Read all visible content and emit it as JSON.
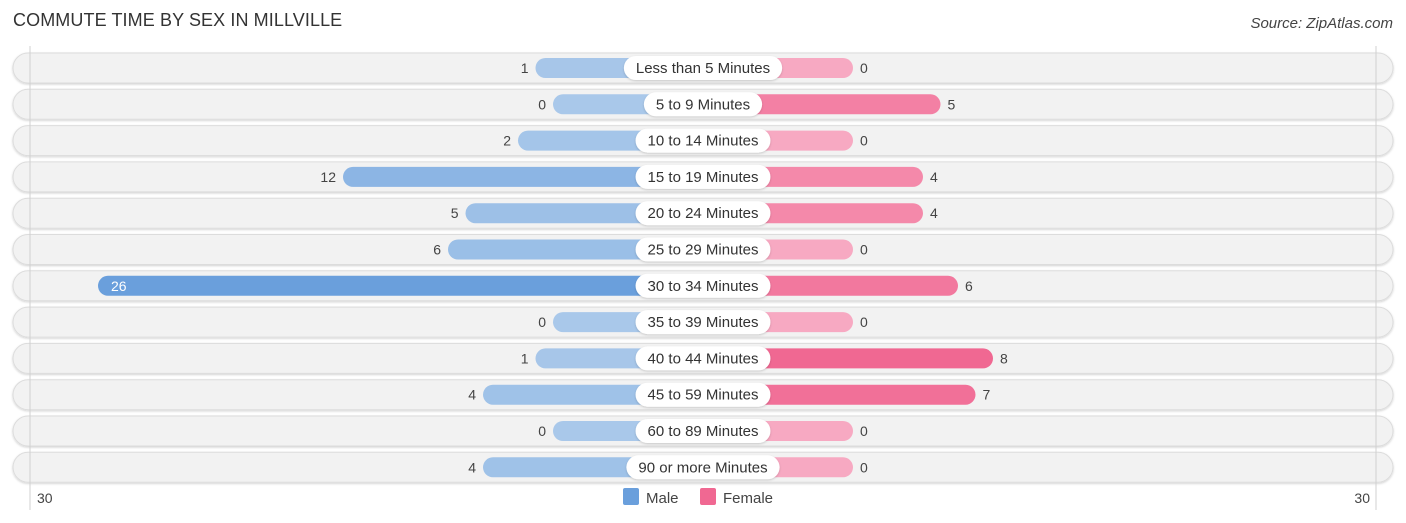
{
  "header": {
    "title": "COMMUTE TIME BY SEX IN MILLVILLE",
    "source": "Source: ZipAtlas.com"
  },
  "colors": {
    "male": "#6a9fdc",
    "male_light": "#a9c8ea",
    "female": "#f06892",
    "female_light": "#f7a9c2",
    "track": "#f2f2f2",
    "track_border": "#dcdcdc"
  },
  "chart_data": {
    "type": "bar",
    "orientation": "horizontal-diverging",
    "title": "COMMUTE TIME BY SEX IN MILLVILLE",
    "categories": [
      "Less than 5 Minutes",
      "5 to 9 Minutes",
      "10 to 14 Minutes",
      "15 to 19 Minutes",
      "20 to 24 Minutes",
      "25 to 29 Minutes",
      "30 to 34 Minutes",
      "35 to 39 Minutes",
      "40 to 44 Minutes",
      "45 to 59 Minutes",
      "60 to 89 Minutes",
      "90 or more Minutes"
    ],
    "series": [
      {
        "name": "Male",
        "values": [
          1,
          0,
          2,
          12,
          5,
          6,
          26,
          0,
          1,
          4,
          0,
          4
        ]
      },
      {
        "name": "Female",
        "values": [
          0,
          5,
          0,
          4,
          4,
          0,
          6,
          0,
          8,
          7,
          0,
          0
        ]
      }
    ],
    "axis": {
      "left_label": "30",
      "right_label": "30",
      "range": [
        -30,
        30
      ]
    },
    "legend": {
      "items": [
        "Male",
        "Female"
      ],
      "position": "bottom-center"
    },
    "xlabel": "",
    "ylabel": ""
  }
}
